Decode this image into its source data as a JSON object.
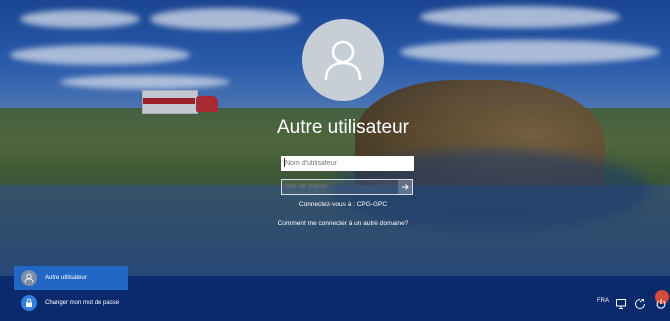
{
  "login": {
    "title": "Autre utilisateur",
    "username_placeholder": "Nom d'utilisateur",
    "password_placeholder": "Mot de passe",
    "connect_to": "Connectez-vous à : CPG-GPC",
    "how_to_connect": "Comment me connecter à un autre domaine?"
  },
  "user_list": [
    {
      "label": "Autre utilisateur",
      "icon": "user-icon",
      "selected": true
    },
    {
      "label": "Changer mon mot de passe",
      "icon": "lock-icon",
      "selected": false
    }
  ],
  "tray": {
    "language": "FRA"
  },
  "colors": {
    "selected_item": "#2266c6",
    "taskbar": "#0b2a6e",
    "accent_red": "#d44a3b"
  }
}
